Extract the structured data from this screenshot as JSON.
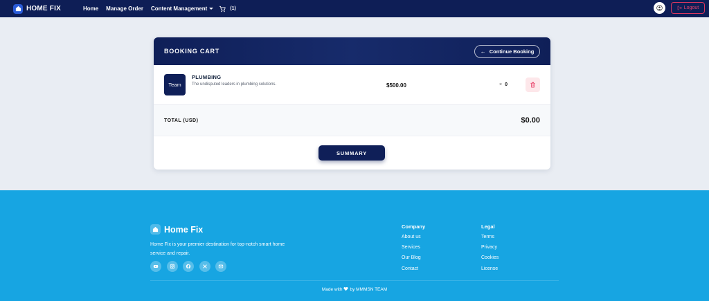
{
  "navbar": {
    "brand": "HOME FIX",
    "links": [
      "Home",
      "Manage Order",
      "Content Management"
    ],
    "cart_count": "(1)",
    "logout_label": "Logout"
  },
  "cart": {
    "title": "BOOKING CART",
    "continue_label": "Continue Booking",
    "item": {
      "thumb_label": "Team",
      "name": "PLUMBING",
      "description": "The undisputed leaders in plumbing solutions.",
      "price": "$500.00",
      "qty_symbol": "×",
      "qty": "0"
    },
    "total_label": "TOTAL (USD)",
    "total_value": "$0.00",
    "summary_label": "SUMMARY"
  },
  "footer": {
    "brand": "Home Fix",
    "description": "Home Fix is your premier destination for top-notch smart home service and repair.",
    "socials": [
      "youtube-icon",
      "instagram-icon",
      "facebook-icon",
      "x-icon",
      "mail-icon"
    ],
    "company": {
      "title": "Company",
      "links": [
        "About us",
        "Services",
        "Our Blog",
        "Contact"
      ]
    },
    "legal": {
      "title": "Legal",
      "links": [
        "Terms",
        "Privacy",
        "Cookies",
        "License"
      ]
    },
    "made_with": "Made with",
    "made_by": "by MMMSN TEAM"
  },
  "colors": {
    "navy": "#0e1e56",
    "footer_blue": "#17a5e2",
    "danger": "#e8456c",
    "page_bg": "#e9edf3"
  }
}
